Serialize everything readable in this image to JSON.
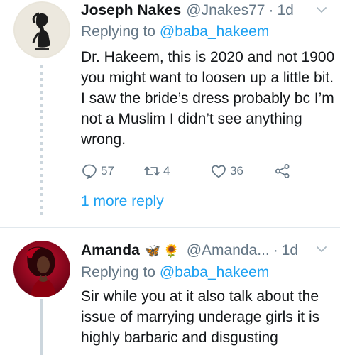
{
  "tweets": [
    {
      "name": "Joseph Nakes",
      "handle": "@Jnakes77",
      "separator": "·",
      "age": "1d",
      "replying_prefix": "Replying to",
      "replying_to": "@baba_hakeem",
      "text": "Dr. Hakeem, this is 2020 and not 1900 you might want to loosen up a little bit. I saw the bride’s dress probably bc I’m not a Muslim I didn’t see anything wrong.",
      "stats": {
        "replies": "57",
        "retweets": "4",
        "likes": "36"
      },
      "more_replies": "1 more reply",
      "avatar_icon": "silhouette-avatar-icon"
    },
    {
      "name": "Amanda",
      "emoji_1": "🦋",
      "emoji_2": "🌻",
      "handle": "@Amanda...",
      "separator": "·",
      "age": "1d",
      "replying_prefix": "Replying to",
      "replying_to": "@baba_hakeem",
      "text": "Sir while you at it also talk about the issue of marrying underage girls it is highly barbaric and disgusting",
      "avatar_icon": "red-portrait-avatar-icon"
    }
  ],
  "colors": {
    "link": "#1da1f2",
    "secondary": "#657786",
    "primary": "#14171a",
    "divider": "#e1e8ed"
  }
}
